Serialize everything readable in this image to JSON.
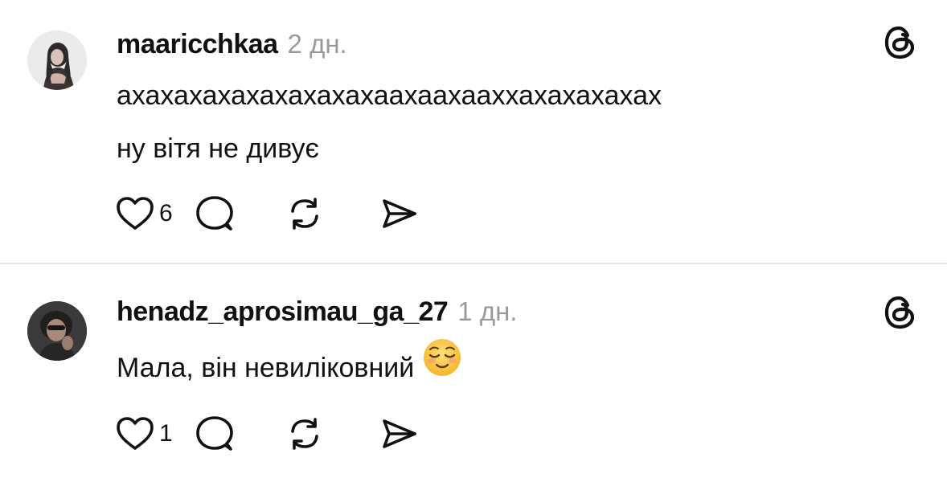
{
  "posts": [
    {
      "username": "maaricchkaa",
      "time": "2 дн.",
      "lines": [
        "ахахахахахахахахахаахаахааххахахахахах",
        "ну вітя не дивує"
      ],
      "likes": "6",
      "avatar": "user-avatar-photo"
    },
    {
      "username": "henadz_aprosimau_ga_27",
      "time": "1 дн.",
      "lines": [
        "Мала, він невиліковний"
      ],
      "emoji": "relieved-face-emoji",
      "likes": "1",
      "avatar": "user-avatar-photo"
    }
  ],
  "icons": {
    "menu": "threads-logo-icon",
    "like": "heart-icon",
    "comment": "comment-bubble-icon",
    "repost": "repost-arrows-icon",
    "share": "send-icon"
  },
  "colors": {
    "text": "#111111",
    "muted": "#9a9a9a",
    "divider": "#e4e4e4"
  }
}
